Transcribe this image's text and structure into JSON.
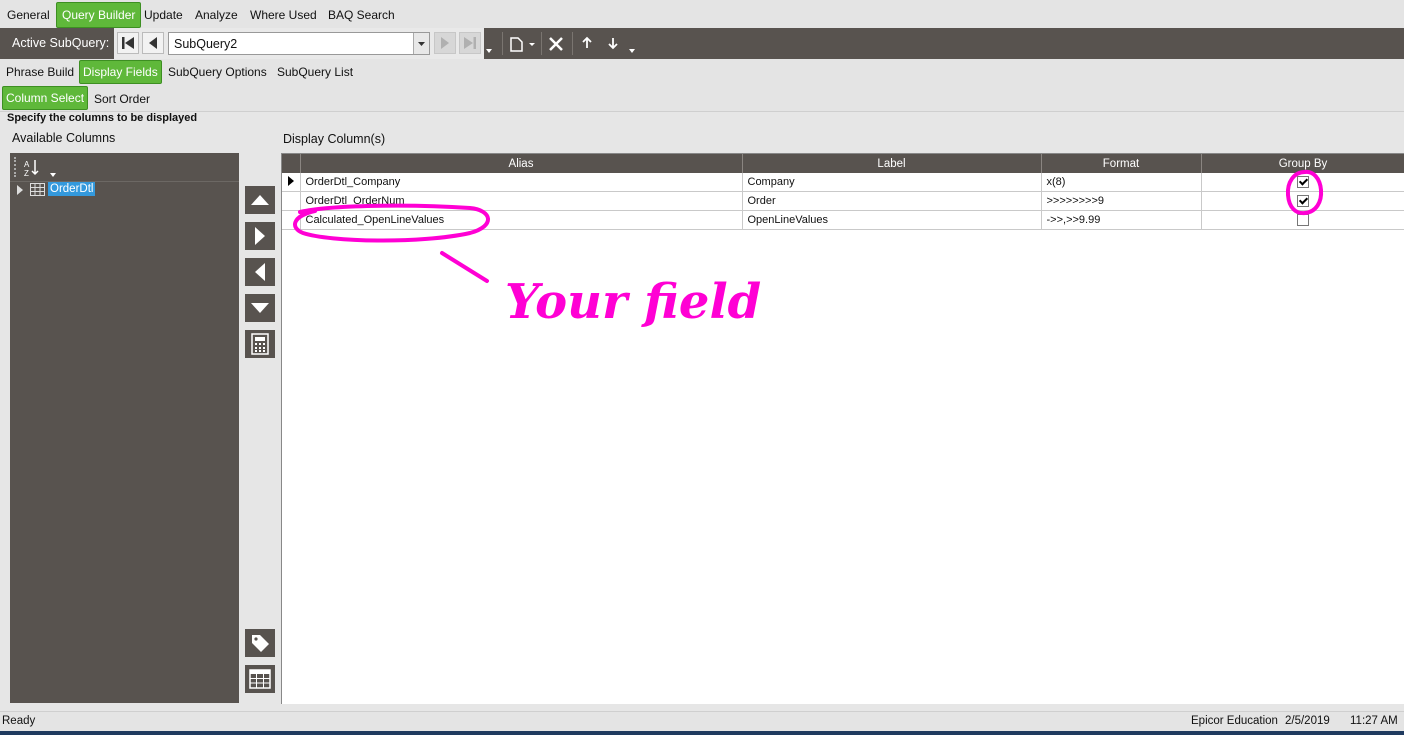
{
  "top_tabs": [
    "General",
    "Query Builder",
    "Update",
    "Analyze",
    "Where Used",
    "BAQ Search"
  ],
  "active_top_tab": "Query Builder",
  "toolbar": {
    "active_subquery_label": "Active SubQuery:",
    "subquery_value": "SubQuery2"
  },
  "sub_tabs": [
    "Phrase Build",
    "Display Fields",
    "SubQuery Options",
    "SubQuery List"
  ],
  "active_sub_tab": "Display Fields",
  "sub_tabs2": [
    "Column Select",
    "Sort Order"
  ],
  "active_sub_tab2": "Column Select",
  "instruction": "Specify the columns to be displayed",
  "available_columns": {
    "title": "Available Columns",
    "tree": [
      {
        "label": "OrderDtl"
      }
    ]
  },
  "display_columns": {
    "title": "Display Column(s)",
    "headers": [
      "Alias",
      "Label",
      "Format",
      "Group By"
    ],
    "rows": [
      {
        "alias": "OrderDtl_Company",
        "label": "Company",
        "format": "x(8)",
        "group_by": true
      },
      {
        "alias": "OrderDtl_OrderNum",
        "label": "Order",
        "format": ">>>>>>>>9",
        "group_by": true
      },
      {
        "alias": "Calculated_OpenLineValues",
        "label": "OpenLineValues",
        "format": "->>,>>9.99",
        "group_by": false
      }
    ]
  },
  "annotation": {
    "text": "Your field",
    "color": "#ff00d4"
  },
  "status": {
    "left": "Ready",
    "company": "Epicor Education",
    "date": "2/5/2019",
    "time": "11:27 AM"
  },
  "colors": {
    "accent_green": "#5fb83a",
    "panel_dark": "#58534f",
    "highlight_blue": "#3399dd"
  }
}
